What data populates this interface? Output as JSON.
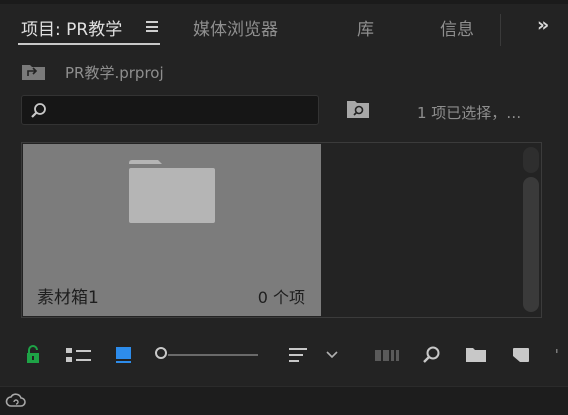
{
  "tabs": [
    {
      "label": "项目: PR教学",
      "active": true
    },
    {
      "label": "媒体浏览器",
      "active": false
    },
    {
      "label": "库",
      "active": false
    },
    {
      "label": "信息",
      "active": false
    }
  ],
  "overflow_label": "»",
  "breadcrumb": {
    "project_file": "PR教学.prproj"
  },
  "search": {
    "value": "",
    "placeholder": ""
  },
  "selection_status": "1 项已选择，…",
  "bin": {
    "name": "素材箱1",
    "item_count": "0 个项"
  },
  "toolbar": {
    "icons": [
      "lock-icon",
      "list-view-icon",
      "icon-view-icon",
      "zoom-slider",
      "sort-icon",
      "chevron-down-icon",
      "automate-to-sequence-icon",
      "find-icon",
      "new-bin-icon",
      "new-item-icon"
    ],
    "zoom_level": 0.0
  },
  "colors": {
    "panel_bg": "#232323",
    "lock_green": "#1ea346",
    "icon_view_blue": "#2d8ceb",
    "tile_bg": "#7c7c7c"
  }
}
